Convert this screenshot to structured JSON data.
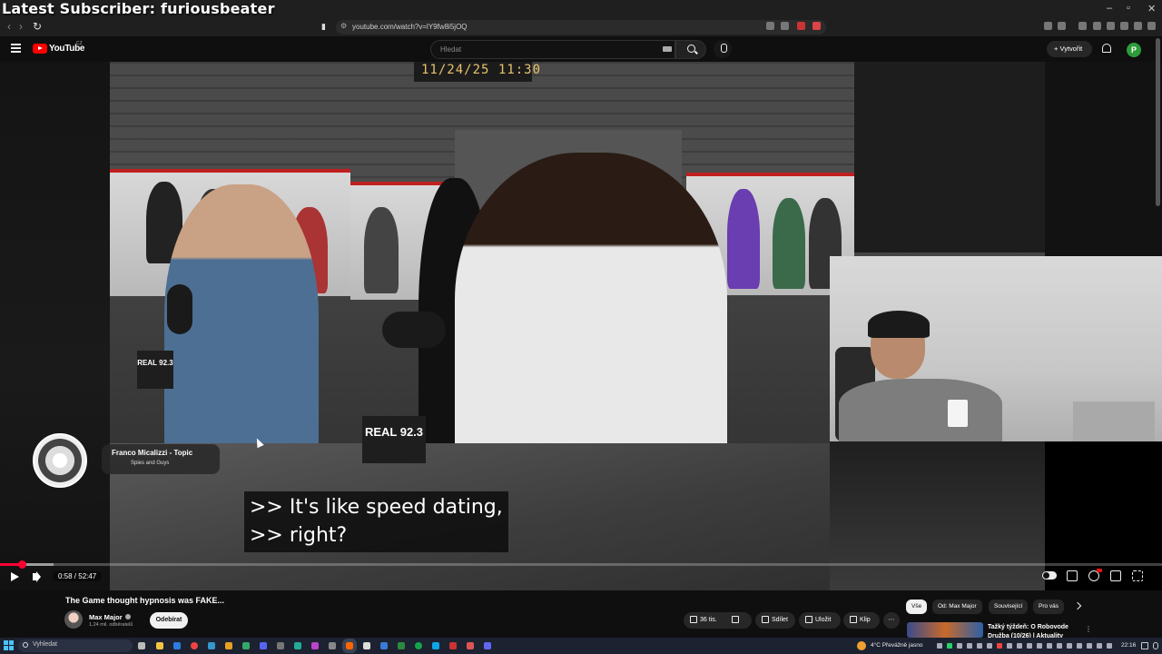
{
  "overlay": {
    "subscriber_text": "Latest Subscriber: furiousbeater"
  },
  "browser": {
    "url": "youtube.com/watch?v=lY9fw8i5jOQ",
    "window_controls": [
      "–",
      "▫",
      "✕"
    ]
  },
  "youtube": {
    "logo_text": "YouTube",
    "region": "CZ",
    "search_placeholder": "Hledat",
    "create_label": "Vytvořit",
    "account_initial": "P"
  },
  "video": {
    "clock_text": "11/24/25 11:30",
    "subtitle_lines": [
      ">> It's like speed dating,",
      ">> right?"
    ],
    "mic_flag_text": "REAL 92.3",
    "music_card": {
      "artist": "Franco Micalizzi - Topic",
      "song": "Spies and Guys"
    },
    "time_display": "0:58 / 52:47",
    "progress": 0.0184,
    "buffered": 0.046
  },
  "below": {
    "title": "The Game thought hypnosis was FAKE...",
    "channel": {
      "name": "Max Major",
      "subscribers": "1,24 mil. odběratelů",
      "subscribe_label": "Odebírat"
    },
    "actions": {
      "likes": "36 tis.",
      "share": "Sdílet",
      "save": "Uložit",
      "clip": "Klip",
      "more": "⋯"
    },
    "chips": [
      "Vše",
      "Od: Max Major",
      "Související",
      "Pro vás"
    ],
    "recommendation": {
      "title_line1": "Tažký týždeň: O Robovode",
      "title_line2": "Družba (10/26) | Aktuality"
    }
  },
  "taskbar": {
    "search_placeholder": "Vyhledat",
    "weather": "4°C  Převážně jasno",
    "time": "22:16"
  }
}
